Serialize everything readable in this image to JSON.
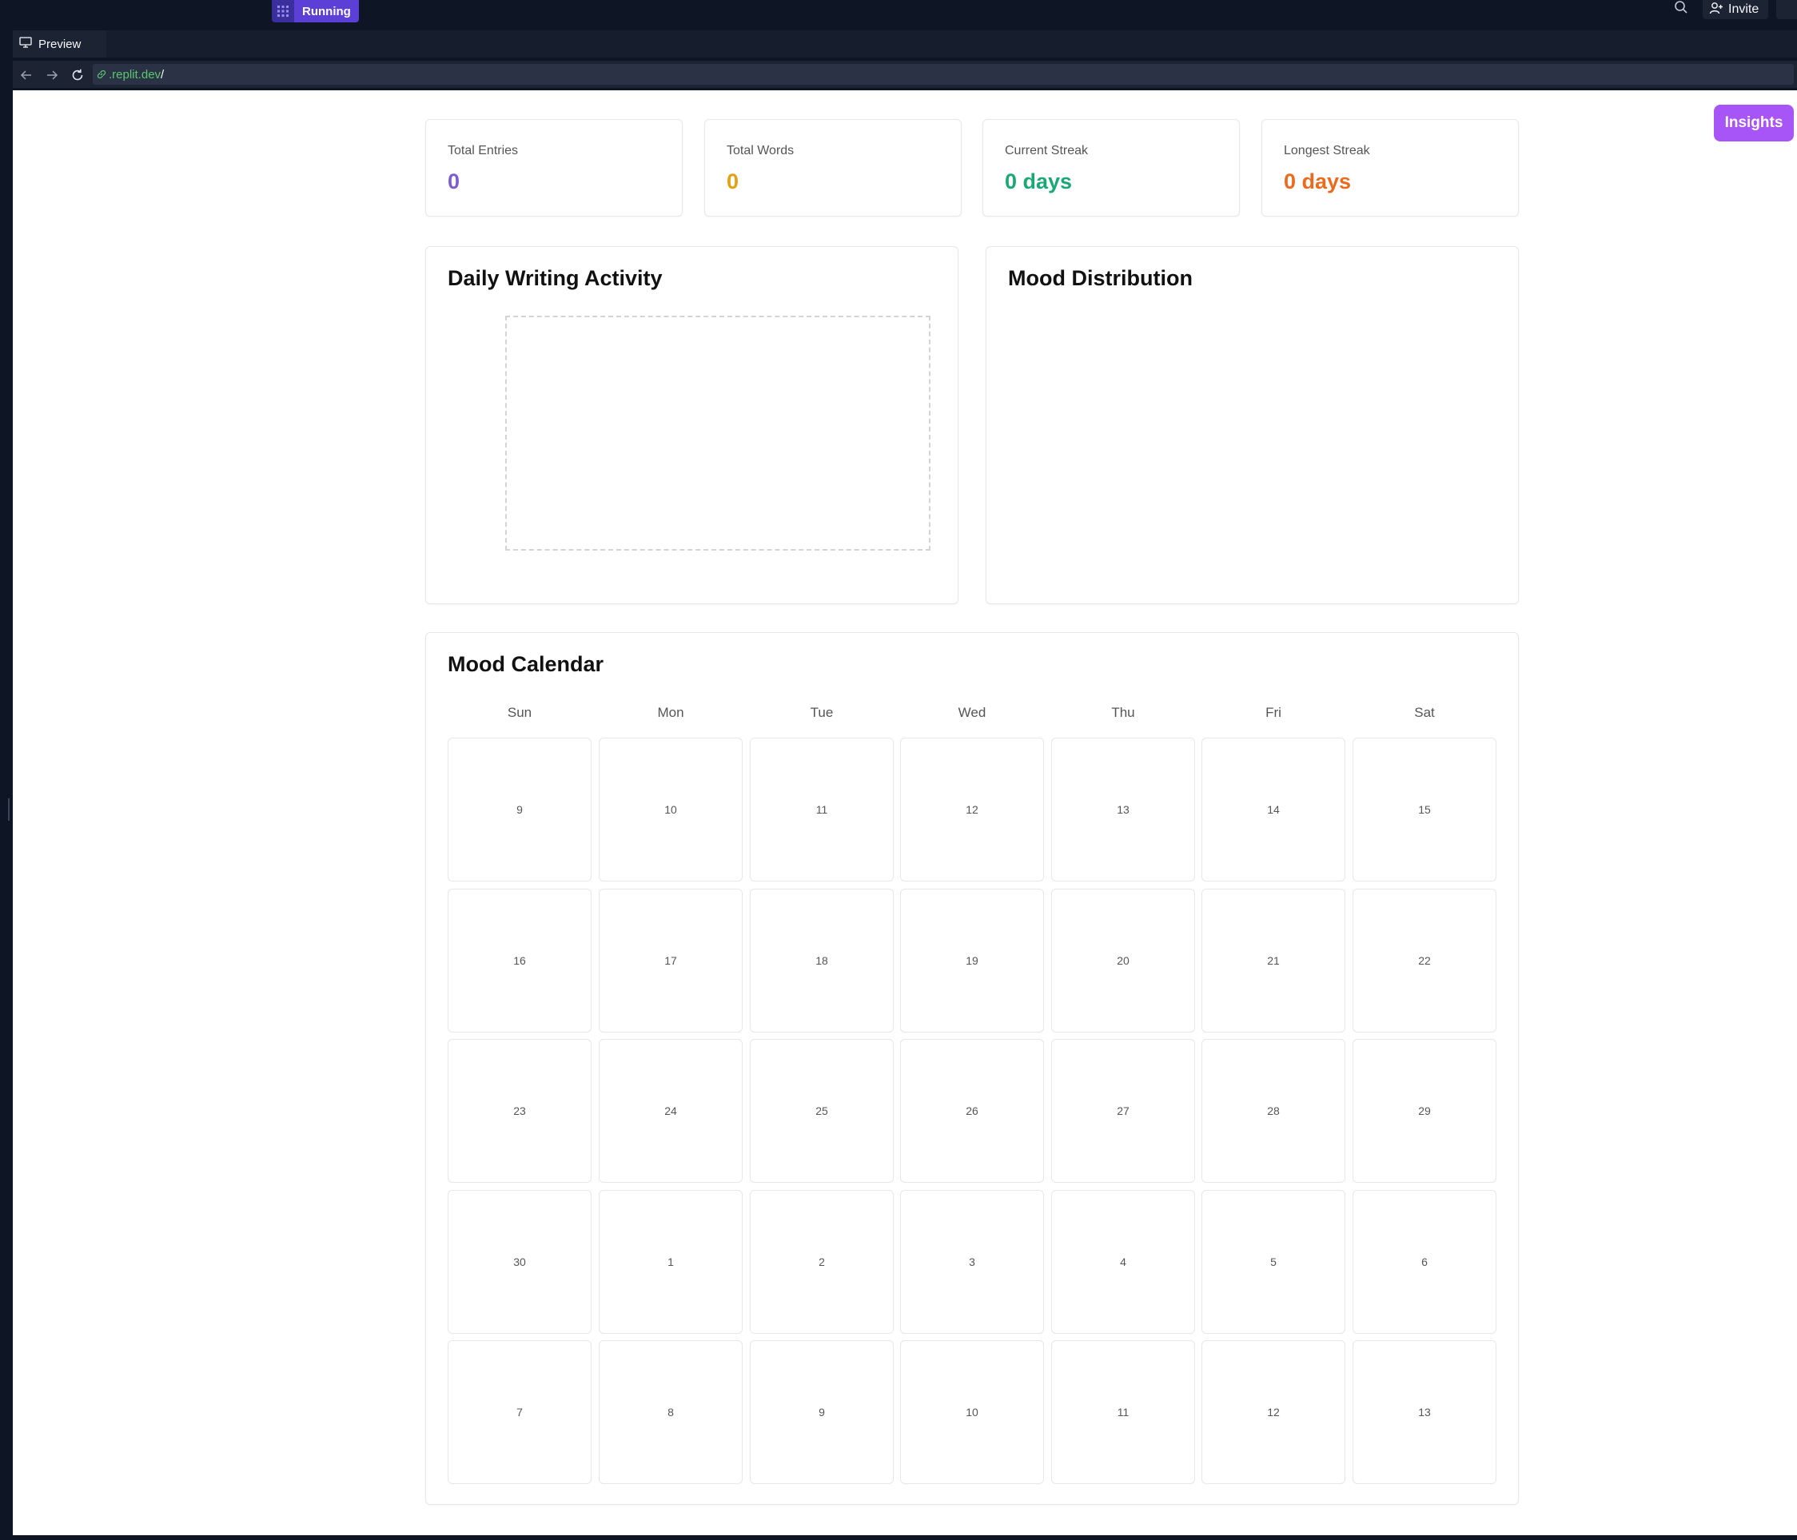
{
  "topbar": {
    "run_label": "Running",
    "invite_label": "Invite"
  },
  "preview_tab": {
    "label": "Preview"
  },
  "url": {
    "host": ".replit.dev",
    "path": "/"
  },
  "insights_label": "Insights",
  "stats": [
    {
      "label": "Total Entries",
      "value": "0",
      "color": "#7c5cd6"
    },
    {
      "label": "Total Words",
      "value": "0",
      "color": "#e0a112"
    },
    {
      "label": "Current Streak",
      "value": "0 days",
      "color": "#1aa876"
    },
    {
      "label": "Longest Streak",
      "value": "0 days",
      "color": "#ea6a1e"
    }
  ],
  "activity_title": "Daily Writing Activity",
  "mood_dist_title": "Mood Distribution",
  "calendar": {
    "title": "Mood Calendar",
    "weekdays": [
      "Sun",
      "Mon",
      "Tue",
      "Wed",
      "Thu",
      "Fri",
      "Sat"
    ],
    "days": [
      "9",
      "10",
      "11",
      "12",
      "13",
      "14",
      "15",
      "16",
      "17",
      "18",
      "19",
      "20",
      "21",
      "22",
      "23",
      "24",
      "25",
      "26",
      "27",
      "28",
      "29",
      "30",
      "1",
      "2",
      "3",
      "4",
      "5",
      "6",
      "7",
      "8",
      "9",
      "10",
      "11",
      "12",
      "13"
    ]
  },
  "colors": {
    "accent": "#a855f7",
    "chrome_bg": "#0e1525",
    "running": "#5b3fd6"
  }
}
